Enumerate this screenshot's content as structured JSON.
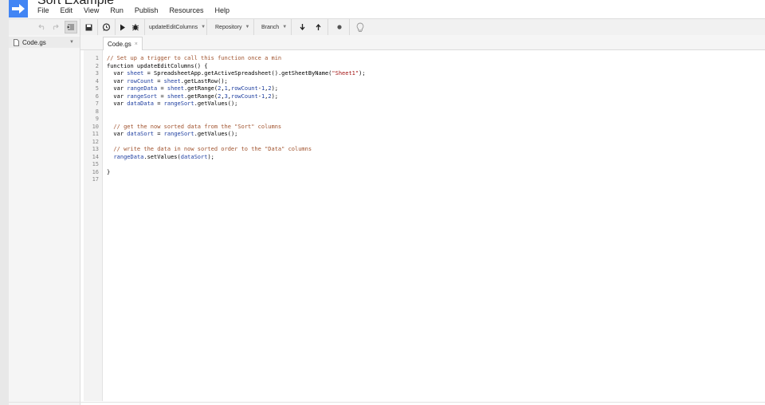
{
  "app": {
    "title": "Sort Example",
    "menu": [
      "File",
      "Edit",
      "View",
      "Run",
      "Publish",
      "Resources",
      "Help"
    ]
  },
  "toolbar": {
    "function_select": "updateEditColumns",
    "repository_label": "Repository",
    "branch_label": "Branch",
    "icons": [
      "undo-icon",
      "redo-icon",
      "indent-icon",
      "save-icon",
      "triggers-icon",
      "run-icon",
      "debug-icon",
      "pull-icon",
      "push-icon",
      "record-icon",
      "lightbulb-icon"
    ]
  },
  "files": [
    {
      "name": "Code.gs"
    }
  ],
  "tabs": [
    {
      "label": "Code.gs",
      "close": "×"
    }
  ],
  "editor": {
    "line_numbers": [
      "1",
      "2",
      "3",
      "4",
      "5",
      "6",
      "7",
      "8",
      "9",
      "10",
      "11",
      "12",
      "13",
      "14",
      "15",
      "16",
      "17"
    ],
    "lines": [
      [
        [
          "comment",
          "// Set up a trigger to call this function once a min"
        ]
      ],
      [
        [
          "keyword",
          "function updateEditColumns() {"
        ]
      ],
      [
        [
          "keyword",
          "  var "
        ],
        [
          "var",
          "sheet"
        ],
        [
          "keyword",
          " = SpreadsheetApp.getActiveSpreadsheet().getSheetByName("
        ],
        [
          "string",
          "\"Sheet1\""
        ],
        [
          "keyword",
          ");"
        ]
      ],
      [
        [
          "keyword",
          "  var "
        ],
        [
          "var",
          "rowCount"
        ],
        [
          "keyword",
          " = "
        ],
        [
          "var",
          "sheet"
        ],
        [
          "keyword",
          ".getLastRow();"
        ]
      ],
      [
        [
          "keyword",
          "  var "
        ],
        [
          "var",
          "rangeData"
        ],
        [
          "keyword",
          " = "
        ],
        [
          "var",
          "sheet"
        ],
        [
          "keyword",
          ".getRange("
        ],
        [
          "number",
          "2"
        ],
        [
          "keyword",
          ","
        ],
        [
          "number",
          "1"
        ],
        [
          "keyword",
          ","
        ],
        [
          "var",
          "rowCount"
        ],
        [
          "keyword",
          "-"
        ],
        [
          "number",
          "1"
        ],
        [
          "keyword",
          ","
        ],
        [
          "number",
          "2"
        ],
        [
          "keyword",
          ");"
        ]
      ],
      [
        [
          "keyword",
          "  var "
        ],
        [
          "var",
          "rangeSort"
        ],
        [
          "keyword",
          " = "
        ],
        [
          "var",
          "sheet"
        ],
        [
          "keyword",
          ".getRange("
        ],
        [
          "number",
          "2"
        ],
        [
          "keyword",
          ","
        ],
        [
          "number",
          "3"
        ],
        [
          "keyword",
          ","
        ],
        [
          "var",
          "rowCount"
        ],
        [
          "keyword",
          "-"
        ],
        [
          "number",
          "1"
        ],
        [
          "keyword",
          ","
        ],
        [
          "number",
          "2"
        ],
        [
          "keyword",
          ");"
        ]
      ],
      [
        [
          "keyword",
          "  var "
        ],
        [
          "var",
          "dataData"
        ],
        [
          "keyword",
          " = "
        ],
        [
          "var",
          "rangeSort"
        ],
        [
          "keyword",
          ".getValues();"
        ]
      ],
      [],
      [],
      [
        [
          "comment",
          "  // get the now sorted data from the \"Sort\" columns"
        ]
      ],
      [
        [
          "keyword",
          "  var "
        ],
        [
          "var",
          "dataSort"
        ],
        [
          "keyword",
          " = "
        ],
        [
          "var",
          "rangeSort"
        ],
        [
          "keyword",
          ".getValues();"
        ]
      ],
      [],
      [
        [
          "comment",
          "  // write the data in now sorted order to the \"Data\" columns"
        ]
      ],
      [
        [
          "keyword",
          "  "
        ],
        [
          "var",
          "rangeData"
        ],
        [
          "keyword",
          ".setValues("
        ],
        [
          "var",
          "dataSort"
        ],
        [
          "keyword",
          ");"
        ]
      ],
      [],
      [
        [
          "keyword",
          "}"
        ]
      ],
      []
    ]
  },
  "colors": {
    "brand": "#4285f4",
    "comment": "#a0522d",
    "variable": "#1f3fa0",
    "string": "#a31515"
  }
}
